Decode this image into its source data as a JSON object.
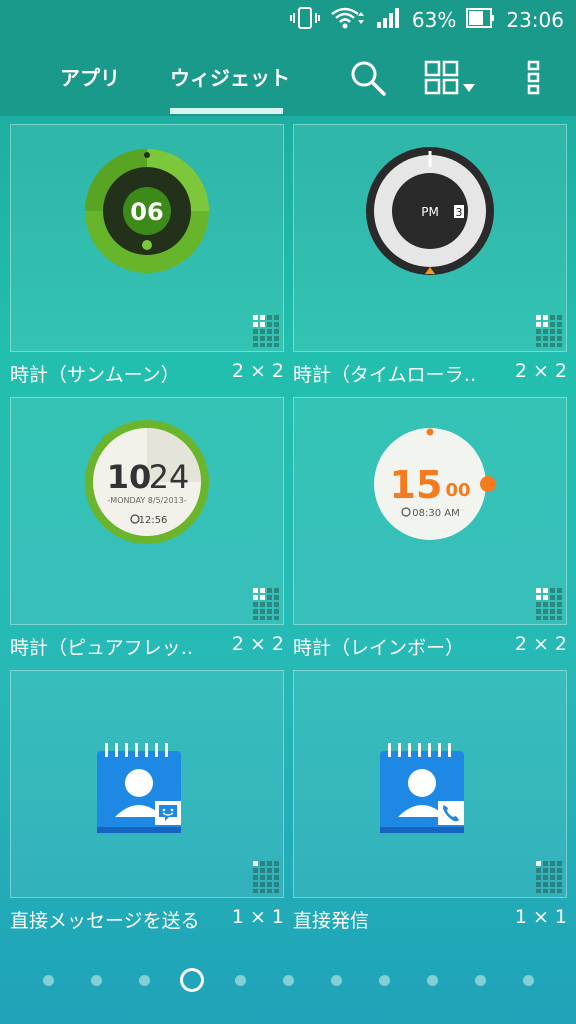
{
  "status_bar": {
    "battery": "63%",
    "time": "23:06"
  },
  "top_bar": {
    "tabs": [
      {
        "label": "アプリ"
      },
      {
        "label": "ウィジェット"
      }
    ],
    "icons": [
      "search-icon",
      "grid-view-dropdown-icon",
      "more-vert-icon"
    ]
  },
  "widgets": [
    {
      "name": "時計（サンムーン）",
      "size": "2 × 2",
      "preview": {
        "time": "06"
      }
    },
    {
      "name": "時計（タイムローラ‥",
      "size": "2 × 2",
      "preview": {
        "ampm": "PM",
        "badge": "3"
      }
    },
    {
      "name": "時計（ピュアフレッ‥",
      "size": "2 × 2",
      "preview": {
        "hour": "10",
        "minute": "24",
        "date": "-MONDAY 8/5/2013-",
        "alarm": "12:56"
      }
    },
    {
      "name": "時計（レインボー）",
      "size": "2 × 2",
      "preview": {
        "hour": "15",
        "minute": "00",
        "alarm": "08:30 AM"
      }
    },
    {
      "name": "直接メッセージを送る",
      "size": "1 × 1"
    },
    {
      "name": "直接発信",
      "size": "1 × 1"
    }
  ],
  "page_indicator": {
    "total": 11,
    "current_index": 3
  },
  "colors": {
    "accent": "#1a9a8a",
    "orange": "#f47b1e",
    "green": "#5fae1f",
    "contact_blue": "#1e88e5"
  }
}
